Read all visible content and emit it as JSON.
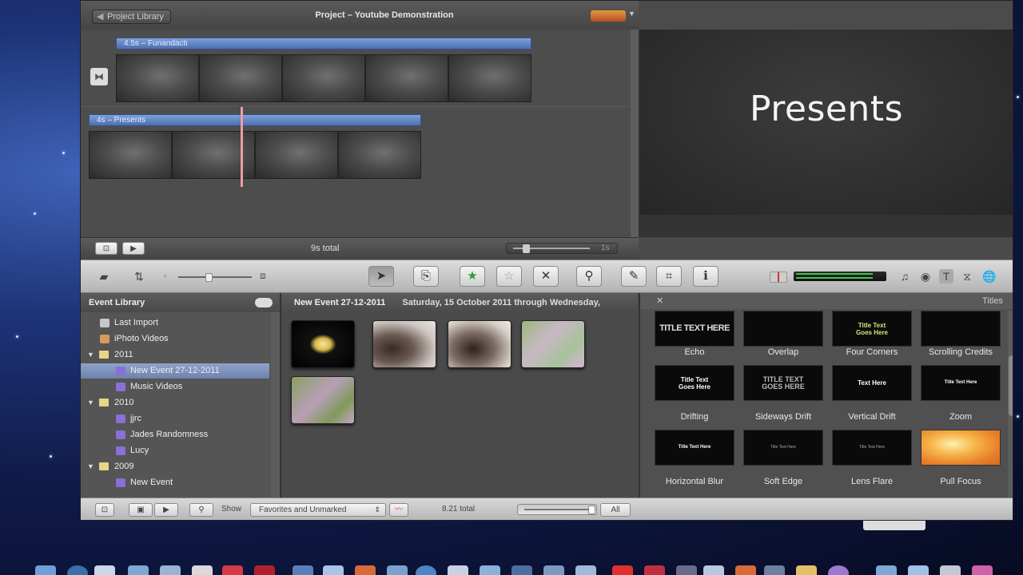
{
  "project": {
    "back_button": "Project Library",
    "title": "Project – Youtube Demonstration",
    "clips": [
      {
        "label": "4.5s – Funandacti"
      },
      {
        "label": "4s – Presents"
      }
    ],
    "total": "9s total",
    "zoom_value": "1s"
  },
  "viewer": {
    "text": "Presents"
  },
  "event_library": {
    "header": "Event Library",
    "items": [
      {
        "label": "Last Import",
        "level": 1
      },
      {
        "label": "iPhoto Videos",
        "level": 1
      },
      {
        "label": "2011",
        "level": 0
      },
      {
        "label": "New Event 27-12-2011",
        "level": 1,
        "selected": true
      },
      {
        "label": "Music Videos",
        "level": 1
      },
      {
        "label": "2010",
        "level": 0
      },
      {
        "label": "jjrc",
        "level": 1
      },
      {
        "label": "Jades Randomness",
        "level": 1
      },
      {
        "label": "Lucy",
        "level": 1
      },
      {
        "label": "2009",
        "level": 0
      },
      {
        "label": "New Event",
        "level": 1
      }
    ]
  },
  "event_browser": {
    "title": "New Event 27-12-2011",
    "dates": "Saturday, 15 October 2011 through Wednesday,"
  },
  "titles_panel": {
    "header": "Titles",
    "tiles": [
      {
        "name": "Echo",
        "preview": "TITLE TEXT HERE"
      },
      {
        "name": "Overlap",
        "preview": ""
      },
      {
        "name": "Four Corners",
        "preview": "Title Text\nGoes Here"
      },
      {
        "name": "Scrolling Credits",
        "preview": ""
      },
      {
        "name": "Drifting",
        "preview": "Title Text\nGoes Here"
      },
      {
        "name": "Sideways Drift",
        "preview": "TITLE TEXT\nGOES HERE"
      },
      {
        "name": "Vertical Drift",
        "preview": "Text Here"
      },
      {
        "name": "Zoom",
        "preview": "Title Text Here"
      },
      {
        "name": "Horizontal Blur",
        "preview": "Title Text Here"
      },
      {
        "name": "Soft Edge",
        "preview": "Title Text Here"
      },
      {
        "name": "Lens Flare",
        "preview": "Title Text Here"
      },
      {
        "name": "Pull Focus",
        "preview": ""
      }
    ]
  },
  "bottom_bar": {
    "show_label": "Show",
    "filter": "Favorites and Unmarked",
    "total": "8.21 total",
    "zoom_label": "All"
  },
  "colors": {
    "clip_bar": "#5b7fc0",
    "playhead": "#f09aa4",
    "selection": "#7d92bd"
  }
}
